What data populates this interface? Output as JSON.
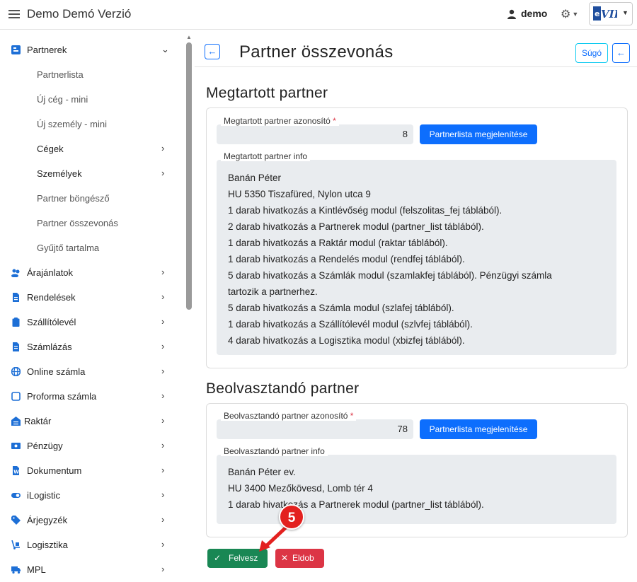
{
  "app_title": "Demo Demó Verzió",
  "user": "demo",
  "logo_text": "eVIR",
  "sidebar": {
    "items": [
      {
        "label": "Partnerek",
        "icon": "partner-card-icon",
        "expanded": true
      },
      {
        "label": "Árajánlatok",
        "icon": "people-icon"
      },
      {
        "label": "Rendelések",
        "icon": "document-icon"
      },
      {
        "label": "Szállítólevél",
        "icon": "clipboard-icon"
      },
      {
        "label": "Számlázás",
        "icon": "invoice-icon"
      },
      {
        "label": "Online számla",
        "icon": "globe-icon"
      },
      {
        "label": "Proforma számla",
        "icon": "square-icon"
      },
      {
        "label": "Raktár",
        "icon": "warehouse-icon"
      },
      {
        "label": "Pénzügy",
        "icon": "money-icon"
      },
      {
        "label": "Dokumentum",
        "icon": "word-doc-icon"
      },
      {
        "label": "iLogistic",
        "icon": "toggle-icon"
      },
      {
        "label": "Árjegyzék",
        "icon": "tag-icon"
      },
      {
        "label": "Logisztika",
        "icon": "hand-truck-icon"
      },
      {
        "label": "MPL",
        "icon": "truck-icon"
      }
    ],
    "subitems": [
      {
        "label": "Partnerlista"
      },
      {
        "label": "Új cég - mini"
      },
      {
        "label": "Új személy - mini"
      },
      {
        "label": "Cégek"
      },
      {
        "label": "Személyek"
      },
      {
        "label": "Partner böngésző"
      },
      {
        "label": "Partner összevonás"
      },
      {
        "label": "Gyűjtő tartalma"
      }
    ]
  },
  "page_title": "Partner összevonás",
  "help_label": "Súgó",
  "kept": {
    "heading": "Megtartott partner",
    "id_label": "Megtartott partner azonosító",
    "required_mark": "*",
    "id_value": "8",
    "list_button": "Partnerlista megjelenítése",
    "info_label": "Megtartott partner info",
    "info_lines": [
      "Banán Péter",
      "HU 5350 Tiszafüred, Nylon utca 9",
      "1 darab hivatkozás a Kintlévőség modul (felszolitas_fej táblából).",
      "2 darab hivatkozás a Partnerek modul (partner_list táblából).",
      "1 darab hivatkozás a Raktár modul (raktar táblából).",
      "1 darab hivatkozás a Rendelés modul (rendfej táblából).",
      "5 darab hivatkozás a Számlák modul (szamlakfej táblából). Pénzügyi számla",
      "tartozik a partnerhez.",
      "5 darab hivatkozás a Számla modul (szlafej táblából).",
      "1 darab hivatkozás a Szállítólevél modul (szlvfej táblából).",
      "4 darab hivatkozás a Logisztika modul (xbizfej táblából)."
    ]
  },
  "merged": {
    "heading": "Beolvasztandó partner",
    "id_label": "Beolvasztandó partner azonosító",
    "required_mark": "*",
    "id_value": "78",
    "list_button": "Partnerlista megjelenítése",
    "info_label": "Beolvasztandó partner info",
    "info_lines": [
      "Banán Péter ev.",
      "HU 3400 Mezőkövesd, Lomb tér 4",
      "1 darab hivatkozás a Partnerek modul (partner_list táblából)."
    ]
  },
  "actions": {
    "save": "Felvesz",
    "discard": "Eldob"
  },
  "annotation_badge": "5",
  "colors": {
    "primary": "#0d6efd",
    "success": "#198754",
    "danger": "#dc3545",
    "badge": "#e3211f"
  }
}
